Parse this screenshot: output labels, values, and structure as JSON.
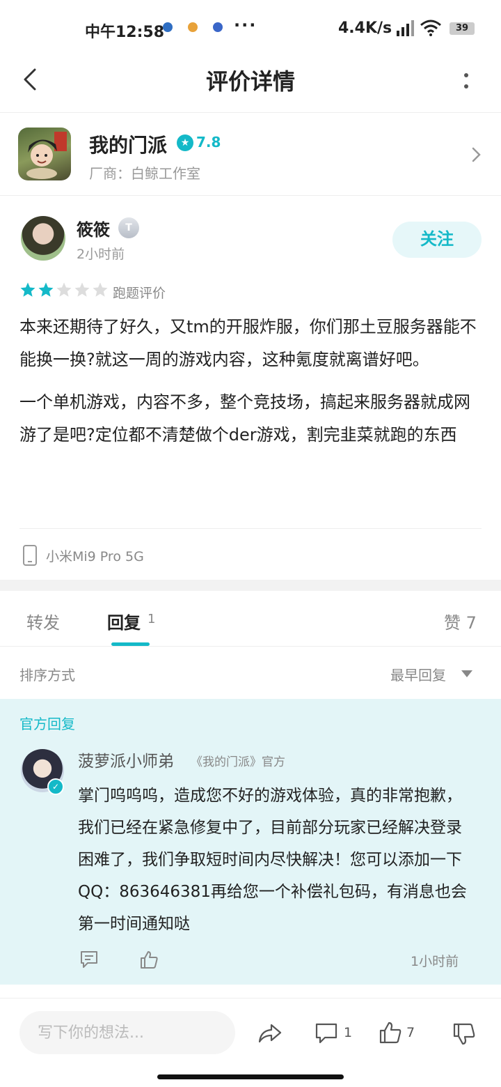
{
  "status_bar": {
    "time": "中午12:58",
    "more": "···",
    "net_speed": "4.4K/s",
    "battery": "39"
  },
  "nav": {
    "title": "评价详情"
  },
  "app": {
    "name": "我的门派",
    "rating": "7.8",
    "vendor": "厂商：白鲸工作室"
  },
  "review": {
    "user": "筱筱",
    "badge": "T",
    "time": "2小时前",
    "follow_label": "关注",
    "stars": 2,
    "max_stars": 5,
    "tag": "跑题评价",
    "paragraphs": [
      "本来还期待了好久，又tm的开服炸服，你们那土豆服务器能不能换一换?就这一周的游戏内容，这种氪度就离谱好吧。",
      "一个单机游戏，内容不多，整个竞技场，搞起来服务器就成网游了是吧?定位都不清楚做个der游戏，割完韭菜就跑的东西"
    ],
    "device": "小米Mi9 Pro 5G"
  },
  "tabs": {
    "forward": "转发",
    "reply": "回复",
    "reply_count": "1",
    "like": "赞 7"
  },
  "sort": {
    "label": "排序方式",
    "value": "最早回复"
  },
  "official_reply": {
    "section_label": "官方回复",
    "name": "菠萝派小师弟",
    "tag": "《我的门派》官方",
    "text": "掌门呜呜呜，造成您不好的游戏体验，真的非常抱歉，我们已经在紧急修复中了，目前部分玩家已经解决登录困难了，我们争取短时间内尽快解决！您可以添加一下QQ：863646381再给您一个补偿礼包码，有消息也会第一时间通知哒",
    "time": "1小时前"
  },
  "bottom_bar": {
    "input_placeholder": "写下你的想法...",
    "comment_count": "1",
    "like_count": "7"
  },
  "colors": {
    "accent": "#14b9c8",
    "official_bg": "#e3f5f7",
    "star_empty": "#dddddd"
  }
}
